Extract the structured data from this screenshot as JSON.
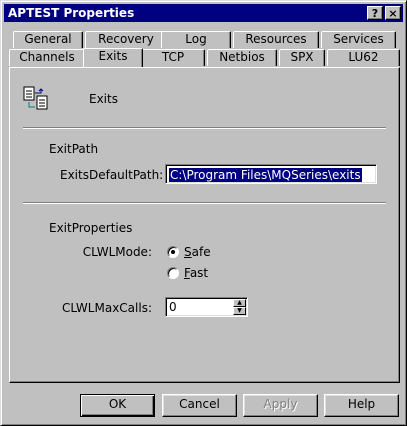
{
  "window": {
    "title": "APTEST Properties",
    "help_button": "?",
    "close_button": "×"
  },
  "tabs": {
    "row1": [
      "General",
      "Recovery",
      "Log",
      "Resources",
      "Services"
    ],
    "row2": [
      "Channels",
      "Exits",
      "TCP",
      "Netbios",
      "SPX",
      "LU62"
    ],
    "active": "Exits"
  },
  "panel": {
    "header_label": "Exits",
    "exit_path": {
      "group_label": "ExitPath",
      "field_label": "ExitsDefaultPath:",
      "field_value": "C:\\Program Files\\MQSeries\\exits"
    },
    "exit_properties": {
      "group_label": "ExitProperties",
      "clwl_mode_label": "CLWLMode:",
      "option_safe_first": "S",
      "option_safe_rest": "afe",
      "option_fast_first": "F",
      "option_fast_rest": "ast",
      "selected": "Safe",
      "max_calls_label": "CLWLMaxCalls:",
      "max_calls_value": "0"
    }
  },
  "buttons": {
    "ok": "OK",
    "cancel": "Cancel",
    "apply": "Apply",
    "help": "Help"
  }
}
